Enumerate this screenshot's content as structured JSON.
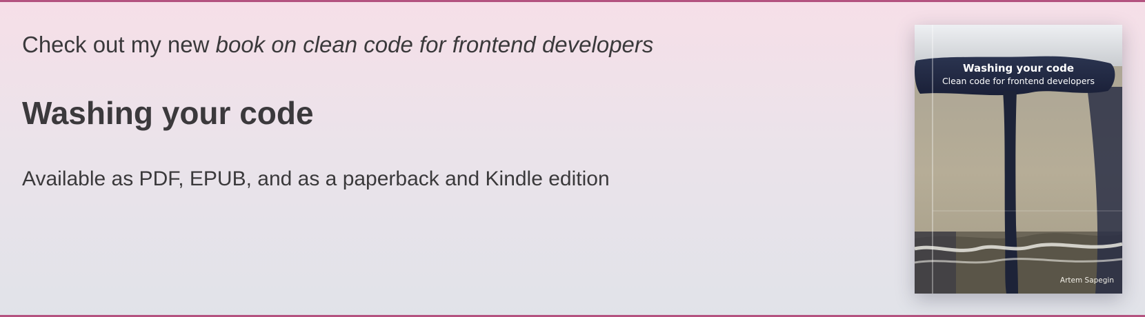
{
  "promo": {
    "intro_prefix": "Check out my new ",
    "intro_link": "book on clean code for frontend developers",
    "title": "Washing your code",
    "formats": "Available as PDF, EPUB, and as a paperback and Kindle edition"
  },
  "cover": {
    "title": "Washing your code",
    "subtitle": "Clean code for frontend developers",
    "author": "Artem Sapegin"
  },
  "colors": {
    "accent_border": "#b4527f",
    "gradient_top": "#f6dfe8",
    "gradient_bottom": "#e1e3e9",
    "text": "#3a393b"
  }
}
